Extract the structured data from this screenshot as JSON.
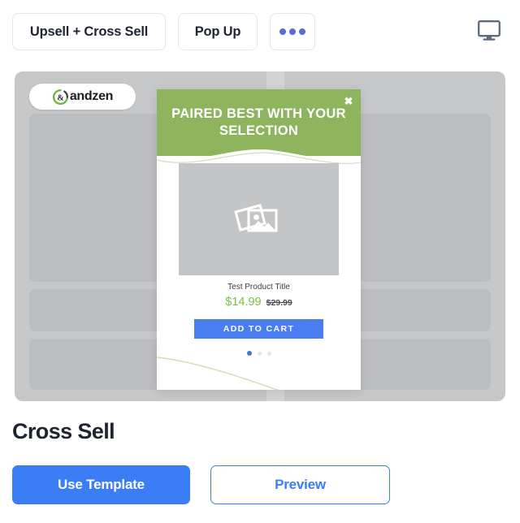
{
  "toolbar": {
    "tabs": [
      {
        "label": "Upsell + Cross Sell",
        "name": "tab-upsell-cross-sell"
      },
      {
        "label": "Pop Up",
        "name": "tab-pop-up"
      }
    ],
    "more_button_label": "",
    "more_icon": "ellipsis-icon",
    "device_icon": "desktop-monitor-icon"
  },
  "preview": {
    "brand_logo": {
      "icon": "gandzen-logo-mark",
      "text": "andzen"
    },
    "modal": {
      "headline": "PAIRED BEST WITH YOUR SELECTION",
      "close_icon": "close-icon",
      "product": {
        "image_placeholder_icon": "image-placeholder-icon",
        "title": "Test Product Title",
        "sale_price": "$14.99",
        "original_price": "$29.99",
        "cta_label": "ADD TO CART"
      },
      "carousel": {
        "total": 3,
        "active_index": 0
      }
    }
  },
  "footer": {
    "template_name": "Cross Sell",
    "use_template_label": "Use Template",
    "preview_label": "Preview"
  },
  "colors": {
    "accent_blue": "#3b7df5",
    "modal_green": "#8eb45e",
    "sale_green": "#7bc043",
    "cart_blue": "#4a7df0",
    "skeleton_gray": "#bcbdbf",
    "stage_gray": "#c6c7c9"
  }
}
